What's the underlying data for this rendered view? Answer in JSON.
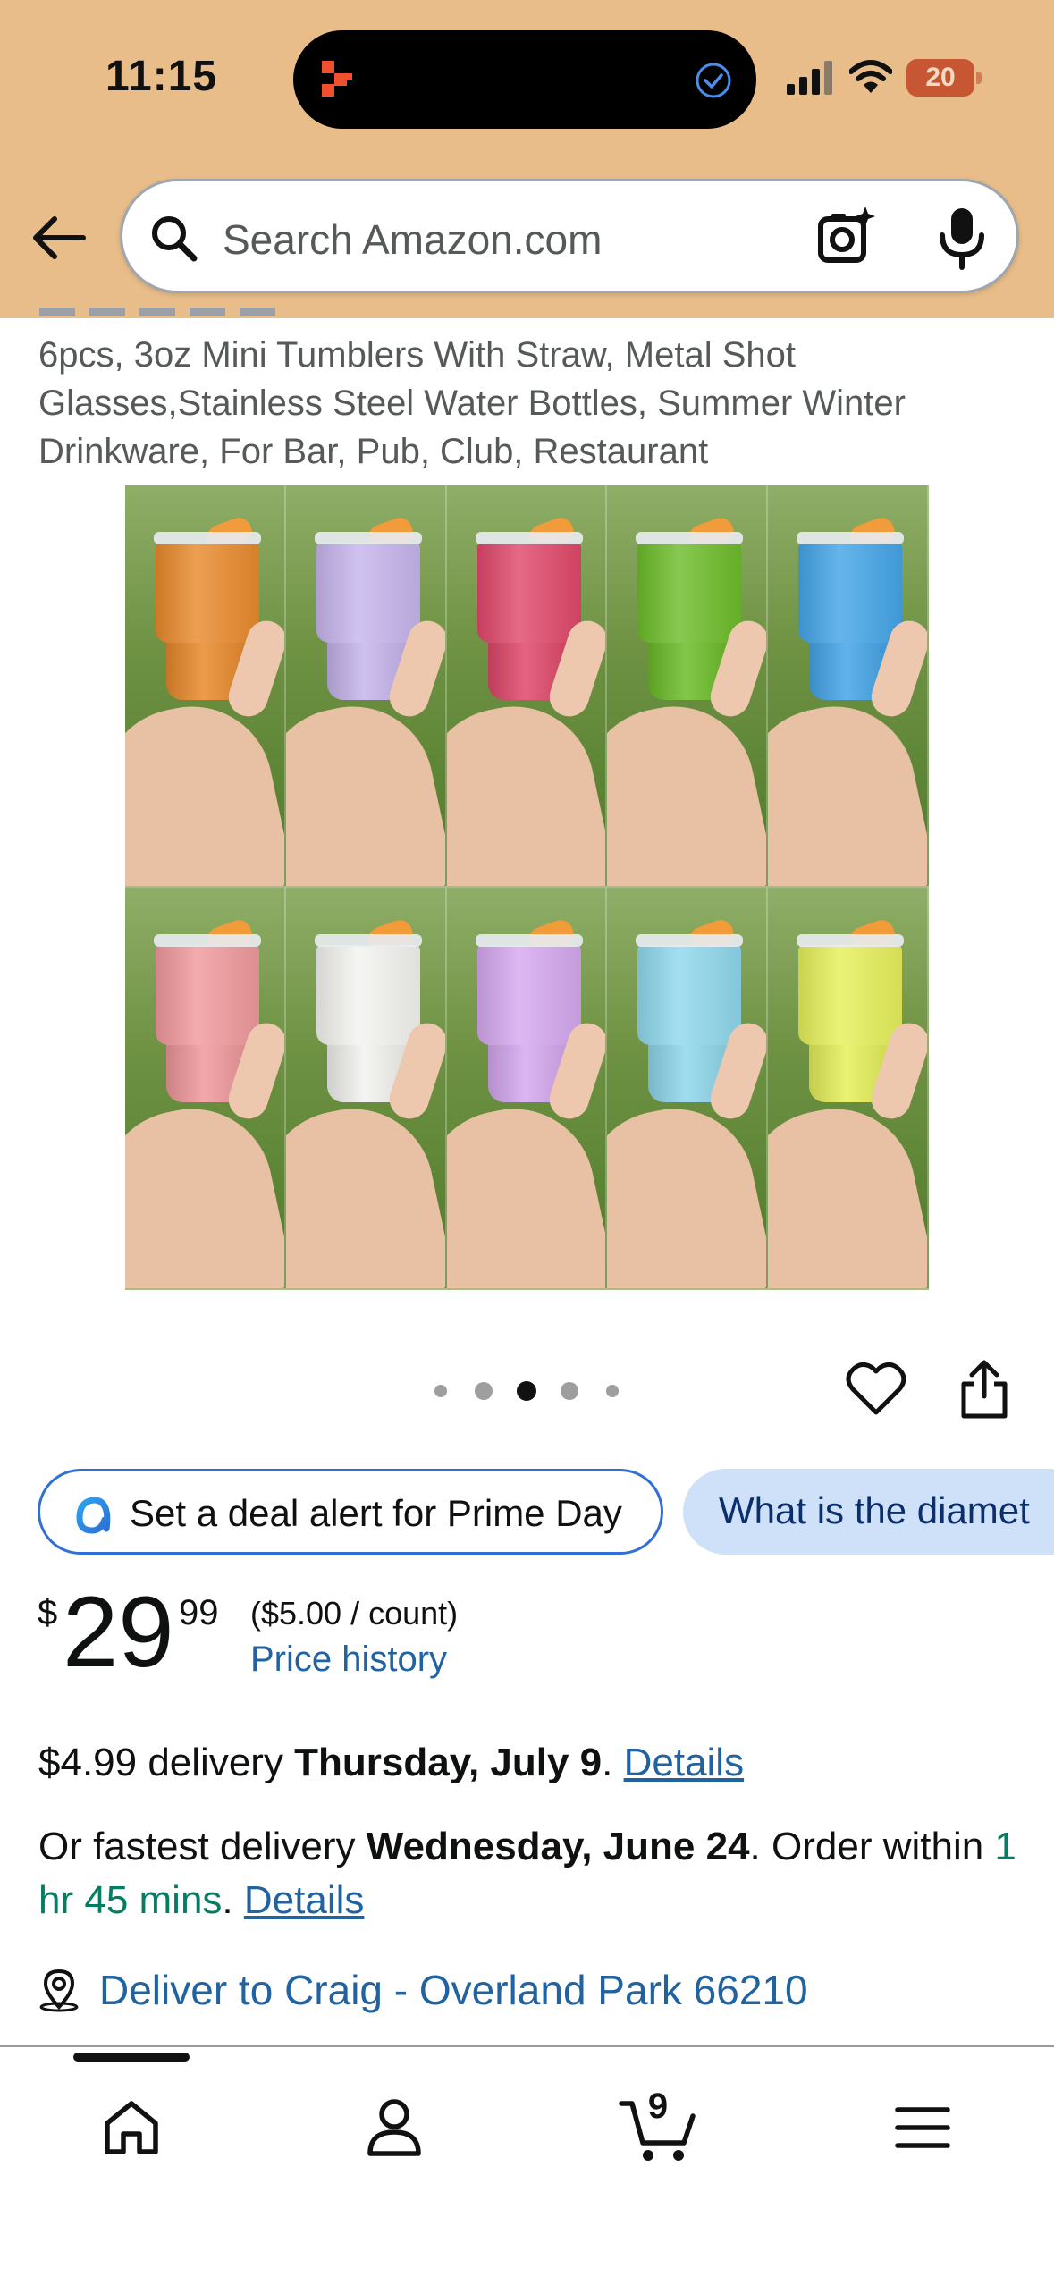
{
  "status_bar": {
    "time": "11:15",
    "battery": "20"
  },
  "search": {
    "placeholder": "Search Amazon.com"
  },
  "product": {
    "title": "6pcs, 3oz Mini Tumblers With Straw, Metal Shot Glasses,Stainless Steel Water Bottles, Summer Winter Drinkware, For Bar, Pub, Club, Restaurant",
    "tumbler_colors": [
      "#e98a2c",
      "#c6b5ec",
      "#e0486a",
      "#6dbd2a",
      "#44a5e8",
      "#f0999c",
      "#f3f3f0",
      "#d5a8ef",
      "#8fd8ec",
      "#e6f05a"
    ],
    "image_count": 5,
    "image_index": 3
  },
  "chips": {
    "deal_alert": "Set a deal alert for Prime Day",
    "question": "What is the diamet"
  },
  "price": {
    "symbol": "$",
    "whole": "29",
    "fraction": "99",
    "unit": "($5.00 / count)",
    "history_link": "Price history"
  },
  "delivery": {
    "standard_prefix": "$4.99 delivery ",
    "standard_date": "Thursday, July 9",
    "standard_suffix": ". ",
    "details": "Details",
    "fastest_prefix": "Or fastest delivery ",
    "fastest_date": "Wednesday, June 24",
    "fastest_mid": ". Order within ",
    "fastest_countdown": "1 hr 45 mins",
    "fastest_suffix": ". ",
    "deliver_to": "Deliver to Craig - Overland Park 66210"
  },
  "bottom_nav": {
    "cart_count": "9"
  },
  "colors": {
    "header_bg": "#e8bd8a",
    "link": "#2162a1",
    "countdown_green": "#067d62",
    "chip_border": "#2f6fd6",
    "chip_question_bg": "#cfe1f9"
  }
}
